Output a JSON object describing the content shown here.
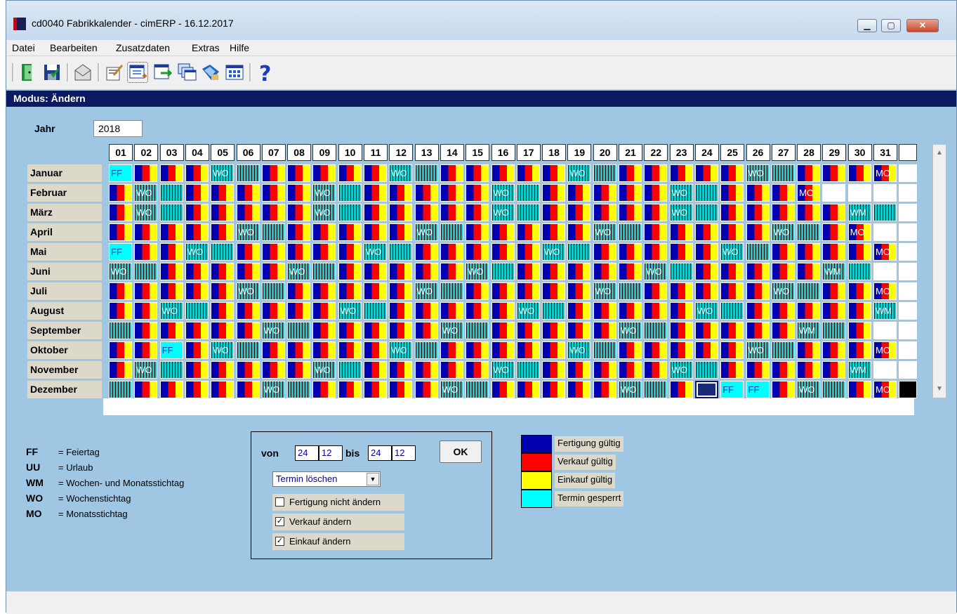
{
  "window": {
    "title": "cd0040 Fabrikkalender - cimERP - 16.12.2017",
    "btn_min": "▁",
    "btn_max": "▢",
    "btn_close": "✕"
  },
  "menu": [
    "Datei",
    "Bearbeiten",
    "Zusatzdaten",
    "Extras",
    "Hilfe"
  ],
  "toolbar": [
    "exit-icon",
    "save-icon",
    "mail-icon",
    "edit-icon",
    "new-window-icon",
    "transfer-icon",
    "windows-icon",
    "tag-icon",
    "grid-icon",
    "help-icon"
  ],
  "mode": "Modus: Ändern",
  "year_label": "Jahr",
  "year_value": "2018",
  "days": [
    "01",
    "02",
    "03",
    "04",
    "05",
    "06",
    "07",
    "08",
    "09",
    "10",
    "11",
    "12",
    "13",
    "14",
    "15",
    "16",
    "17",
    "18",
    "19",
    "20",
    "21",
    "22",
    "23",
    "24",
    "25",
    "26",
    "27",
    "28",
    "29",
    "30",
    "31"
  ],
  "months": [
    {
      "name": "Januar",
      "length": 31,
      "first": 1,
      "labels": {
        "1": "FF",
        "5": "WO",
        "12": "WO",
        "19": "WO",
        "26": "WO",
        "31": "MO"
      },
      "special": {
        "1": "ff"
      }
    },
    {
      "name": "Februar",
      "length": 28,
      "first": 4,
      "labels": {
        "2": "WO",
        "9": "WO",
        "16": "WO",
        "23": "WO",
        "28": "MO"
      },
      "special": {}
    },
    {
      "name": "März",
      "length": 31,
      "first": 4,
      "labels": {
        "2": "WO",
        "9": "WO",
        "16": "WO",
        "23": "WO",
        "30": "WM"
      },
      "special": {}
    },
    {
      "name": "April",
      "length": 30,
      "first": 0,
      "labels": {
        "6": "WO",
        "13": "WO",
        "20": "WO",
        "27": "WO",
        "30": "MO"
      },
      "special": {}
    },
    {
      "name": "Mai",
      "length": 31,
      "first": 2,
      "labels": {
        "1": "FF",
        "4": "WO",
        "11": "WO",
        "18": "WO",
        "25": "WO",
        "31": "MO"
      },
      "special": {
        "1": "ff"
      }
    },
    {
      "name": "Juni",
      "length": 30,
      "first": 5,
      "labels": {
        "1": "WO",
        "8": "WO",
        "15": "WO",
        "22": "WO",
        "29": "WM"
      },
      "special": {}
    },
    {
      "name": "Juli",
      "length": 31,
      "first": 0,
      "labels": {
        "6": "WO",
        "13": "WO",
        "20": "WO",
        "27": "WO",
        "31": "MO"
      },
      "special": {}
    },
    {
      "name": "August",
      "length": 31,
      "first": 3,
      "labels": {
        "3": "WO",
        "10": "WO",
        "17": "WO",
        "24": "WO",
        "31": "WM"
      },
      "special": {}
    },
    {
      "name": "September",
      "length": 30,
      "first": 6,
      "labels": {
        "7": "WO",
        "14": "WO",
        "21": "WO",
        "28": "WM"
      },
      "special": {}
    },
    {
      "name": "Oktober",
      "length": 31,
      "first": 1,
      "labels": {
        "3": "FF",
        "5": "WO",
        "12": "WO",
        "19": "WO",
        "26": "WO",
        "31": "MO"
      },
      "special": {
        "3": "ff"
      }
    },
    {
      "name": "November",
      "length": 30,
      "first": 4,
      "labels": {
        "2": "WO",
        "9": "WO",
        "16": "WO",
        "23": "WO",
        "30": "WM"
      },
      "special": {}
    },
    {
      "name": "Dezember",
      "length": 31,
      "first": 6,
      "labels": {
        "7": "WO",
        "14": "WO",
        "21": "WO",
        "25": "FF",
        "26": "FF",
        "28": "WO",
        "31": "MO"
      },
      "special": {
        "24": "sel",
        "25": "ff",
        "26": "ff"
      }
    }
  ],
  "legend": [
    {
      "code": "FF",
      "text": "= Feiertag"
    },
    {
      "code": "UU",
      "text": "= Urlaub"
    },
    {
      "code": "WM",
      "text": "= Wochen- und Monatsstichtag"
    },
    {
      "code": "WO",
      "text": "= Wochenstichtag"
    },
    {
      "code": "MO",
      "text": "= Monatsstichtag"
    }
  ],
  "range": {
    "von_label": "von",
    "von_day": "24",
    "von_month": "12",
    "bis_label": "bis",
    "bis_day": "24",
    "bis_month": "12",
    "ok": "OK"
  },
  "action": {
    "selected": "Termin löschen"
  },
  "checks": [
    {
      "label": "Fertigung nicht ändern",
      "checked": false
    },
    {
      "label": "Verkauf  ändern",
      "checked": true
    },
    {
      "label": "Einkauf  ändern",
      "checked": true
    }
  ],
  "color_legend": [
    {
      "color": "#0000b0",
      "label": "Fertigung gültig"
    },
    {
      "color": "#ff0000",
      "label": "Verkauf gültig"
    },
    {
      "color": "#ffff00",
      "label": "Einkauf gültig"
    },
    {
      "color": "#00ffff",
      "label": "Termin gesperrt"
    }
  ],
  "colors": {
    "fertigung": "#0000b0",
    "verkauf": "#ff0000",
    "einkauf": "#ffff00",
    "gesperrt": "#00ffff",
    "weekend": "#18c8c8"
  }
}
